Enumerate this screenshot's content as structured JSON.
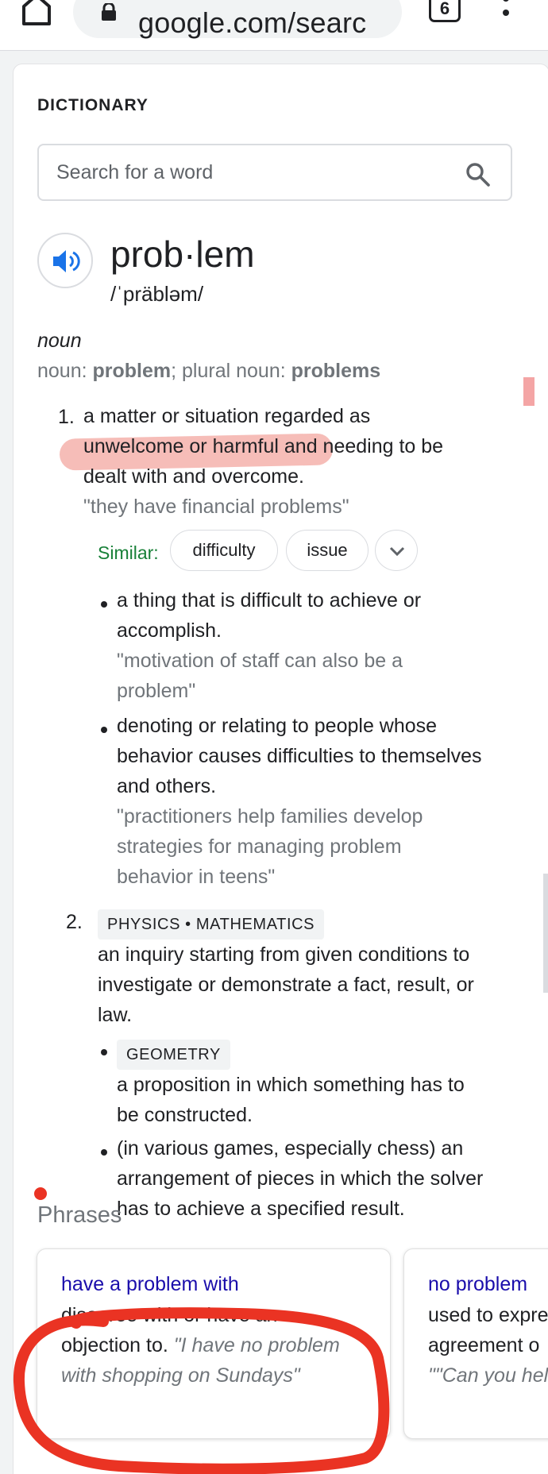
{
  "browser": {
    "url_text": "google.com/searc",
    "tab_count": "6"
  },
  "dictionary": {
    "section_label": "DICTIONARY",
    "search_placeholder": "Search for a word",
    "headword": "prob·lem",
    "phonetic": "/ˈpräbləm/",
    "part_of_speech": "noun",
    "forms": {
      "prefix": "noun: ",
      "singular": "problem",
      "middle": "; plural noun: ",
      "plural": "problems"
    },
    "senses": [
      {
        "number": "1.",
        "lines": [
          "a matter or situation regarded as",
          "unwelcome or harmful and needing to be",
          "dealt with and overcome."
        ],
        "example": "\"they have financial problems\"",
        "similar_label": "Similar:",
        "similar": [
          "difficulty",
          "issue"
        ],
        "subsenses": [
          {
            "lines": [
              "a thing that is difficult to achieve or",
              "accomplish."
            ],
            "example_lines": [
              "\"motivation of staff can also be a",
              "problem\""
            ]
          },
          {
            "lines": [
              "denoting or relating to people whose",
              "behavior causes difficulties to themselves",
              "and others."
            ],
            "example_lines": [
              "\"practitioners help families develop",
              "strategies for managing problem",
              "behavior in teens\""
            ]
          }
        ]
      },
      {
        "number": "2.",
        "tag": "PHYSICS • MATHEMATICS",
        "lines": [
          "an inquiry starting from given conditions to",
          "investigate or demonstrate a fact, result, or",
          "law."
        ],
        "subsenses": [
          {
            "tag": "GEOMETRY",
            "lines": [
              "a proposition in which something has to",
              "be constructed."
            ]
          },
          {
            "lines": [
              "(in various games, especially chess) an",
              "arrangement of pieces in which the solver",
              "has to achieve a specified result."
            ]
          }
        ]
      }
    ],
    "phrases_title": "Phrases",
    "phrases": [
      {
        "phrase": "have a problem with",
        "def_lines": [
          "disagree with or have an",
          "objection to."
        ],
        "example_lines": [
          "\"I have no problem",
          "with shopping on Sundays\""
        ]
      },
      {
        "phrase": "no problem",
        "def_lines": [
          "used to expre",
          "agreement o"
        ],
        "example_lines": [
          "\"\"Can you hel"
        ]
      }
    ]
  },
  "colors": {
    "link": "#1a0dab",
    "similar_label": "#188038",
    "muted_text": "#70757a",
    "annotation_red": "#ea3323"
  },
  "icons": [
    "home-icon",
    "lock-icon",
    "more-vert-icon",
    "search-icon",
    "speaker-icon",
    "chevron-down-icon"
  ]
}
